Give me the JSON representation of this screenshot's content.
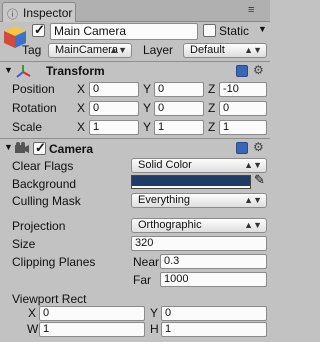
{
  "window": {
    "tab_title": "Inspector"
  },
  "object": {
    "name": "Main Camera",
    "active": true,
    "static_label": "Static",
    "static": false,
    "tag_label": "Tag",
    "tag": "MainCamera",
    "layer_label": "Layer",
    "layer": "Default"
  },
  "transform": {
    "title": "Transform",
    "rows": [
      {
        "label": "Position",
        "x": "0",
        "y": "0",
        "z": "-10"
      },
      {
        "label": "Rotation",
        "x": "0",
        "y": "0",
        "z": "0"
      },
      {
        "label": "Scale",
        "x": "1",
        "y": "1",
        "z": "1"
      }
    ],
    "axis": {
      "x": "X",
      "y": "Y",
      "z": "Z"
    }
  },
  "camera": {
    "title": "Camera",
    "enabled": true,
    "clear_flags_label": "Clear Flags",
    "clear_flags": "Solid Color",
    "background_label": "Background",
    "background_color": "#1f3c66",
    "culling_mask_label": "Culling Mask",
    "culling_mask": "Everything",
    "projection_label": "Projection",
    "projection": "Orthographic",
    "size_label": "Size",
    "size": "320",
    "clipping_label": "Clipping Planes",
    "near_label": "Near",
    "near": "0.3",
    "far_label": "Far",
    "far": "1000",
    "viewport_label": "Viewport Rect",
    "viewport": {
      "x_label": "X",
      "x": "0",
      "y_label": "Y",
      "y": "0",
      "w_label": "W",
      "w": "1",
      "h_label": "H",
      "h": "1"
    }
  },
  "colors": {
    "panel": "#c2c2c2",
    "accent_blue": "#3a66b8"
  }
}
